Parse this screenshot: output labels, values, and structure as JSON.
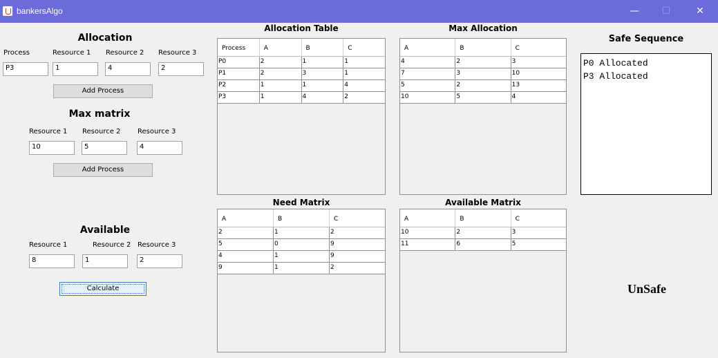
{
  "window": {
    "title": "bankersAlgo",
    "minimize": "—",
    "maximize": "☐",
    "close": "✕"
  },
  "allocation": {
    "heading": "Allocation",
    "labels": [
      "Process",
      "Resource 1",
      "Resource 2",
      "Resource 3"
    ],
    "values": [
      "P3",
      "1",
      "4",
      "2"
    ],
    "button": "Add Process"
  },
  "max_matrix": {
    "heading": "Max matrix",
    "labels": [
      "Resource 1",
      "Resource 2",
      "Resource 3"
    ],
    "values": [
      "10",
      "5",
      "4"
    ],
    "button": "Add Process"
  },
  "available": {
    "heading": "Available",
    "labels": [
      "Resource 1",
      "Resource 2",
      "Resource 3"
    ],
    "values": [
      "8",
      "1",
      "2"
    ],
    "button": "Calculate"
  },
  "tables": {
    "allocation_table": {
      "title": "Allocation Table",
      "headers": [
        "Process",
        "A",
        "B",
        "C"
      ],
      "rows": [
        [
          "P0",
          "2",
          "1",
          "1"
        ],
        [
          "P1",
          "2",
          "3",
          "1"
        ],
        [
          "P2",
          "1",
          "1",
          "4"
        ],
        [
          "P3",
          "1",
          "4",
          "2"
        ]
      ]
    },
    "max_allocation": {
      "title": "Max Allocation",
      "headers": [
        "A",
        "B",
        "C"
      ],
      "rows": [
        [
          "4",
          "2",
          "3"
        ],
        [
          "7",
          "3",
          "10"
        ],
        [
          "5",
          "2",
          "13"
        ],
        [
          "10",
          "5",
          "4"
        ]
      ]
    },
    "need_matrix": {
      "title": "Need Matrix",
      "headers": [
        "A",
        "B",
        "C"
      ],
      "rows": [
        [
          "2",
          "1",
          "2"
        ],
        [
          "5",
          "0",
          "9"
        ],
        [
          "4",
          "1",
          "9"
        ],
        [
          "9",
          "1",
          "2"
        ]
      ]
    },
    "available_matrix": {
      "title": "Available Matrix",
      "headers": [
        "A",
        "B",
        "C"
      ],
      "rows": [
        [
          "10",
          "2",
          "3"
        ],
        [
          "11",
          "6",
          "5"
        ]
      ]
    }
  },
  "safe_sequence": {
    "heading": "Safe Sequence",
    "lines": [
      "P0 Allocated",
      "P3 Allocated"
    ]
  },
  "result": "UnSafe"
}
